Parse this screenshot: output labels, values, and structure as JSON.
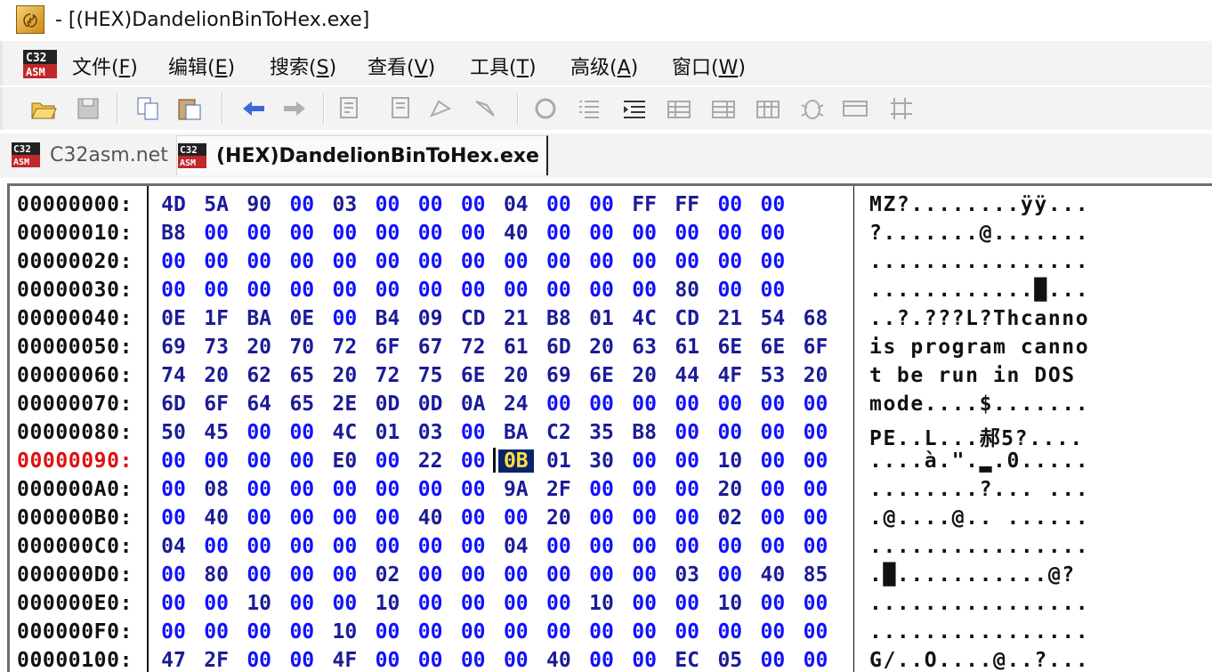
{
  "window": {
    "title": "- [(HEX)DandelionBinToHex.exe]"
  },
  "menu": [
    {
      "text": "文件(",
      "key": "F",
      "close": ")"
    },
    {
      "text": "编辑(",
      "key": "E",
      "close": ")"
    },
    {
      "text": "搜索(",
      "key": "S",
      "close": ")"
    },
    {
      "text": "查看(",
      "key": "V",
      "close": ")"
    },
    {
      "text": "工具(",
      "key": "T",
      "close": ")"
    },
    {
      "text": "高级(",
      "key": "A",
      "close": ")"
    },
    {
      "text": "窗口(",
      "key": "W",
      "close": ")"
    }
  ],
  "toolbar_icons": [
    "open-folder-icon",
    "save-icon",
    "copy-icon",
    "paste-icon",
    "back-arrow-icon",
    "forward-arrow-icon",
    "disasm-icon",
    "disasm-back-icon",
    "jump-icon",
    "jump-back-icon",
    "refresh-icon",
    "list-icon",
    "indent-icon",
    "grid-icon",
    "grid2-icon",
    "grid3-icon",
    "bug-icon",
    "window-icon",
    "columns-icon"
  ],
  "tabs": [
    {
      "label": "C32asm.net",
      "active": false
    },
    {
      "label": "(HEX)DandelionBinToHex.exe",
      "active": true
    }
  ],
  "hex": {
    "current_row": 9,
    "selected_byte": {
      "row": 9,
      "col": 8
    },
    "rows": [
      {
        "addr": "00000000:",
        "bytes": [
          "4D",
          "5A",
          "90",
          "00",
          "03",
          "00",
          "00",
          "00",
          "04",
          "00",
          "00",
          "FF",
          "FF",
          "00",
          "00"
        ],
        "ascii": "MZ?........ÿÿ..."
      },
      {
        "addr": "00000010:",
        "bytes": [
          "B8",
          "00",
          "00",
          "00",
          "00",
          "00",
          "00",
          "00",
          "40",
          "00",
          "00",
          "00",
          "00",
          "00",
          "00"
        ],
        "ascii": "?.......@......."
      },
      {
        "addr": "00000020:",
        "bytes": [
          "00",
          "00",
          "00",
          "00",
          "00",
          "00",
          "00",
          "00",
          "00",
          "00",
          "00",
          "00",
          "00",
          "00",
          "00"
        ],
        "ascii": "................"
      },
      {
        "addr": "00000030:",
        "bytes": [
          "00",
          "00",
          "00",
          "00",
          "00",
          "00",
          "00",
          "00",
          "00",
          "00",
          "00",
          "00",
          "80",
          "00",
          "00"
        ],
        "ascii": "............█..."
      },
      {
        "addr": "00000040:",
        "bytes": [
          "0E",
          "1F",
          "BA",
          "0E",
          "00",
          "B4",
          "09",
          "CD",
          "21",
          "B8",
          "01",
          "4C",
          "CD",
          "21",
          "54",
          "68"
        ],
        "ascii": "..?.???L?Thcanno"
      },
      {
        "addr": "00000050:",
        "bytes": [
          "69",
          "73",
          "20",
          "70",
          "72",
          "6F",
          "67",
          "72",
          "61",
          "6D",
          "20",
          "63",
          "61",
          "6E",
          "6E",
          "6F"
        ],
        "ascii": "is program canno"
      },
      {
        "addr": "00000060:",
        "bytes": [
          "74",
          "20",
          "62",
          "65",
          "20",
          "72",
          "75",
          "6E",
          "20",
          "69",
          "6E",
          "20",
          "44",
          "4F",
          "53",
          "20"
        ],
        "ascii": "t be run in DOS "
      },
      {
        "addr": "00000070:",
        "bytes": [
          "6D",
          "6F",
          "64",
          "65",
          "2E",
          "0D",
          "0D",
          "0A",
          "24",
          "00",
          "00",
          "00",
          "00",
          "00",
          "00",
          "00"
        ],
        "ascii": "mode....$......."
      },
      {
        "addr": "00000080:",
        "bytes": [
          "50",
          "45",
          "00",
          "00",
          "4C",
          "01",
          "03",
          "00",
          "BA",
          "C2",
          "35",
          "B8",
          "00",
          "00",
          "00",
          "00"
        ],
        "ascii": "PE..L...郝5?...."
      },
      {
        "addr": "00000090:",
        "bytes": [
          "00",
          "00",
          "00",
          "00",
          "E0",
          "00",
          "22",
          "00",
          "0B",
          "01",
          "30",
          "00",
          "00",
          "10",
          "00",
          "00"
        ],
        "ascii": "....à.\".▂.0....."
      },
      {
        "addr": "000000A0:",
        "bytes": [
          "00",
          "08",
          "00",
          "00",
          "00",
          "00",
          "00",
          "00",
          "9A",
          "2F",
          "00",
          "00",
          "00",
          "20",
          "00",
          "00"
        ],
        "ascii": "........?... ..."
      },
      {
        "addr": "000000B0:",
        "bytes": [
          "00",
          "40",
          "00",
          "00",
          "00",
          "00",
          "40",
          "00",
          "00",
          "20",
          "00",
          "00",
          "00",
          "02",
          "00",
          "00"
        ],
        "ascii": ".@....@.. ......"
      },
      {
        "addr": "000000C0:",
        "bytes": [
          "04",
          "00",
          "00",
          "00",
          "00",
          "00",
          "00",
          "00",
          "04",
          "00",
          "00",
          "00",
          "00",
          "00",
          "00",
          "00"
        ],
        "ascii": "................"
      },
      {
        "addr": "000000D0:",
        "bytes": [
          "00",
          "80",
          "00",
          "00",
          "00",
          "02",
          "00",
          "00",
          "00",
          "00",
          "00",
          "00",
          "03",
          "00",
          "40",
          "85"
        ],
        "ascii": ".█...........@?"
      },
      {
        "addr": "000000E0:",
        "bytes": [
          "00",
          "00",
          "10",
          "00",
          "00",
          "10",
          "00",
          "00",
          "00",
          "00",
          "10",
          "00",
          "00",
          "10",
          "00",
          "00"
        ],
        "ascii": "................"
      },
      {
        "addr": "000000F0:",
        "bytes": [
          "00",
          "00",
          "00",
          "00",
          "10",
          "00",
          "00",
          "00",
          "00",
          "00",
          "00",
          "00",
          "00",
          "00",
          "00",
          "00"
        ],
        "ascii": "................"
      },
      {
        "addr": "00000100:",
        "bytes": [
          "47",
          "2F",
          "00",
          "00",
          "4F",
          "00",
          "00",
          "00",
          "00",
          "40",
          "00",
          "00",
          "EC",
          "05",
          "00",
          "00"
        ],
        "ascii": "G/..O....@..?..."
      }
    ]
  }
}
